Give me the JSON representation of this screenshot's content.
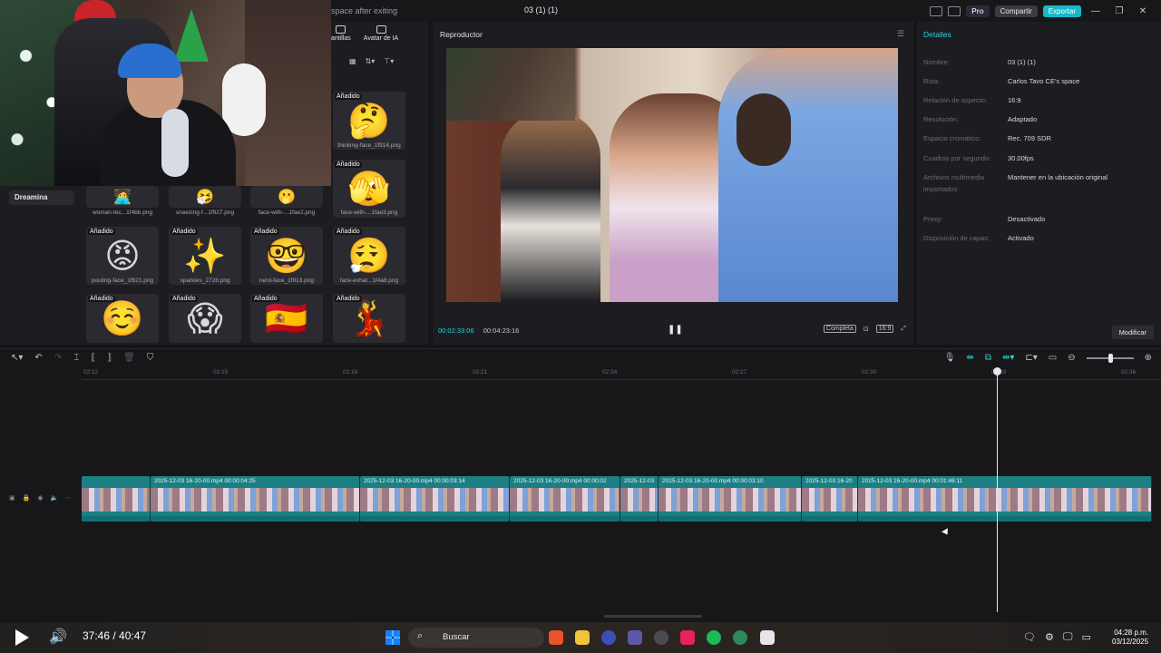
{
  "topbar": {
    "hint": "space after exiting",
    "project_name": "03 (1) (1)",
    "pro_label": "Pro",
    "share_label": "Compartir",
    "export_label": "Exportar"
  },
  "left_panel": {
    "tabs": [
      {
        "label": "antillas",
        "icon": "templates-icon"
      },
      {
        "label": "Avatar de IA",
        "icon": "ai-avatar-icon"
      }
    ],
    "sidebar_item": "Dreamina",
    "added_badge": "Añadido",
    "media": [
      {
        "emoji": "🤔",
        "label": "thinking-face_1f914.png",
        "added": true
      },
      {
        "emoji": "🫣",
        "label": "face-with-...1fae3.png",
        "added": true
      },
      {
        "emoji": "🧑‍💻",
        "label": "woman-tec...1f4bb.png",
        "added": false
      },
      {
        "emoji": "🤧",
        "label": "sneezing-f...1f927.png",
        "added": false
      },
      {
        "emoji": "🫢",
        "label": "face-with-...1fae2.png",
        "added": false
      },
      {
        "emoji": "😡",
        "label": "pouting-face_1f621.png",
        "added": true
      },
      {
        "emoji": "✨",
        "label": "sparkles_2728.png",
        "added": true
      },
      {
        "emoji": "🤓",
        "label": "nerd-face_1f913.png",
        "added": true
      },
      {
        "emoji": "😮‍💨",
        "label": "face-exhal...1f4a8.png",
        "added": true
      },
      {
        "emoji": "☺️",
        "label": "",
        "added": true
      },
      {
        "emoji": "😱",
        "label": "",
        "added": true
      },
      {
        "emoji": "🇪🇸",
        "label": "",
        "added": true
      },
      {
        "emoji": "💃",
        "label": "",
        "added": true
      }
    ]
  },
  "player": {
    "title": "Reproductor",
    "current_time": "00:02:33:06",
    "total_time": "00:04:23:16",
    "fit_label": "Completa",
    "ratio_label": "16:9"
  },
  "details": {
    "title": "Detalles",
    "rows": [
      {
        "key": "Nombre:",
        "value": "03 (1) (1)"
      },
      {
        "key": "Ruta:",
        "value": "Carlos Tavo CE's space"
      },
      {
        "key": "Relación de aspecto:",
        "value": "16:9"
      },
      {
        "key": "Resolución:",
        "value": "Adaptado"
      },
      {
        "key": "Espacio cromático:",
        "value": "Rec. 709 SDR"
      },
      {
        "key": "Cuadros por segundo:",
        "value": "30.00fps"
      },
      {
        "key": "Archivos multimedia importados:",
        "value": "Mantener en la ubicación original"
      },
      {
        "key": "Proxy:",
        "value": "Desactivado"
      },
      {
        "key": "Disposición de capas:",
        "value": "Activado"
      }
    ],
    "modify_label": "Modificar"
  },
  "timeline": {
    "ticks": [
      "02:12",
      "02:15",
      "02:18",
      "02:21",
      "02:24",
      "02:27",
      "02:30",
      "02:33",
      "02:36"
    ],
    "clips": [
      {
        "label": ""
      },
      {
        "label": "2025-12-03 16-20-00.mp4  00:00:04:25"
      },
      {
        "label": "2025-12-03 16-20-00.mp4  00:00:03:14"
      },
      {
        "label": "2025-12-03 16-20-00.mp4 00:00:02"
      },
      {
        "label": "2025-12-03"
      },
      {
        "label": "2025-12-03 16-20-00.mp4  00:00:03:10"
      },
      {
        "label": "2025-12-03 16-20"
      },
      {
        "label": "2025-12-03 16-20-00.mp4  00:01:46:11"
      }
    ]
  },
  "taskbar": {
    "media_time": "37:46 / 40:47",
    "search_label": "Buscar",
    "clock_time": "04:28 p.m.",
    "clock_date": "03/12/2025"
  }
}
